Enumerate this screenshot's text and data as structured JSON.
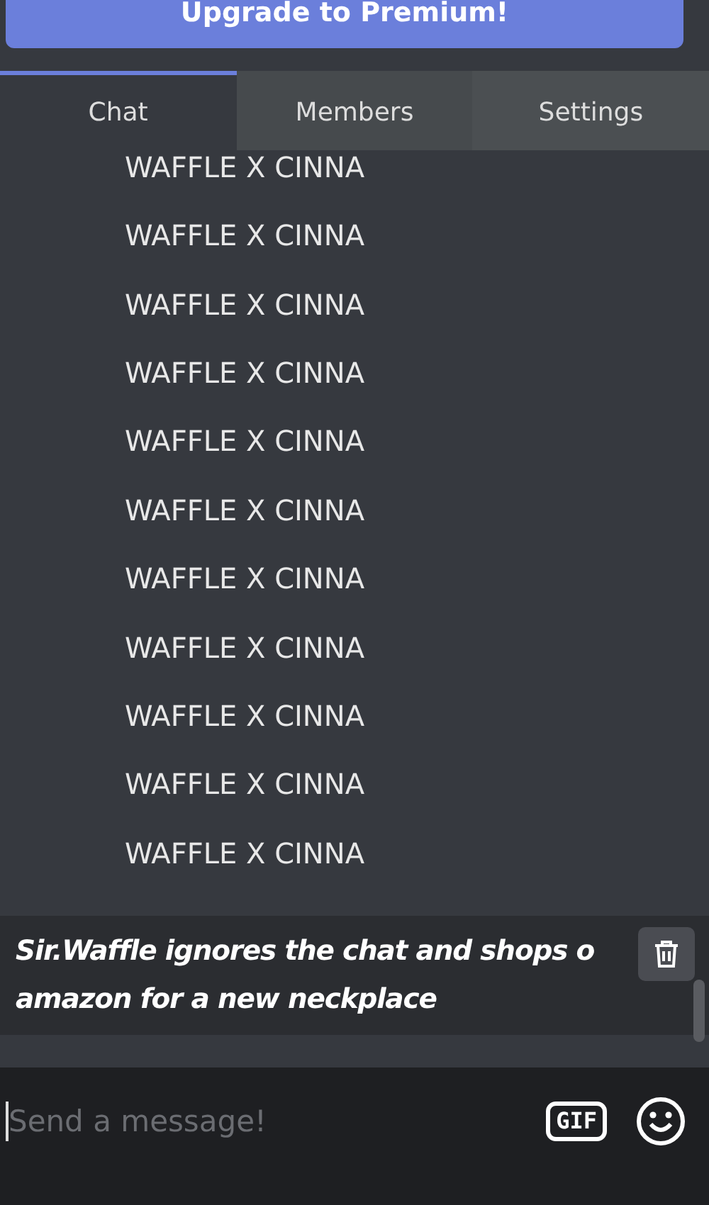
{
  "premium_button": {
    "label": "Upgrade to Premium!"
  },
  "tabs": [
    {
      "label": "Chat",
      "selected": true
    },
    {
      "label": "Members",
      "selected": false
    },
    {
      "label": "Settings",
      "selected": false
    }
  ],
  "chat_lines": [
    "WAFFLE X CINNA",
    "WAFFLE X CINNA",
    "WAFFLE X CINNA",
    "WAFFLE X CINNA",
    "WAFFLE X CINNA",
    "WAFFLE X CINNA",
    "WAFFLE X CINNA",
    "WAFFLE X CINNA",
    "WAFFLE X CINNA",
    "WAFFLE X CINNA",
    "WAFFLE X CINNA"
  ],
  "action_message": {
    "lines": [
      "Sir.Waffle ignores the chat and shops o",
      "amazon for a new neckplace"
    ]
  },
  "composer": {
    "placeholder": "Send a message!",
    "gif_button": "GIF"
  }
}
